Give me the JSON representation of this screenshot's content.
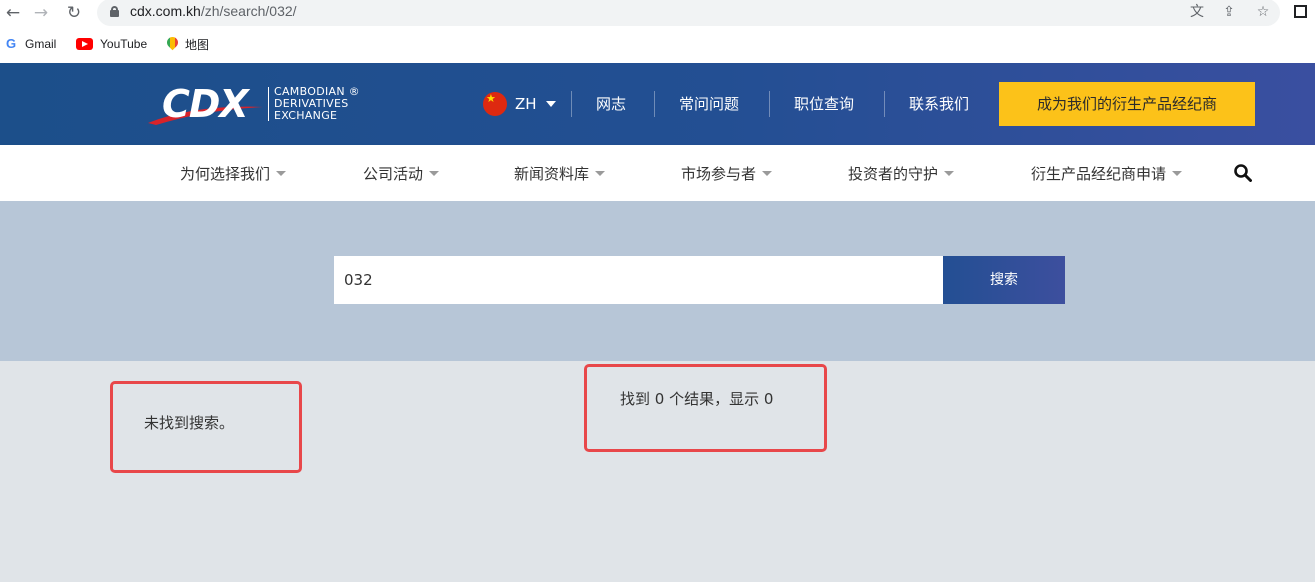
{
  "browser": {
    "url_host": "cdx.com.kh",
    "url_path": "/zh/search/032/",
    "bookmarks": [
      {
        "label": "Gmail",
        "icon": "google-icon"
      },
      {
        "label": "YouTube",
        "icon": "youtube-icon"
      },
      {
        "label": "地图",
        "icon": "maps-icon"
      }
    ]
  },
  "header": {
    "logo_text": "CDX",
    "logo_lines": [
      "CAMBODIAN ®",
      "DERIVATIVES",
      "EXCHANGE"
    ],
    "language": "ZH",
    "links": [
      "网志",
      "常问问题",
      "职位查询",
      "联系我们"
    ],
    "cta_label": "成为我们的衍生产品经纪商",
    "accent_color": "#fcc219",
    "brand_color": "#1c4f8a"
  },
  "nav": {
    "items": [
      "为何选择我们",
      "公司活动",
      "新闻资料库",
      "市场参与者",
      "投资者的守护",
      "衍生产品经纪商申请"
    ]
  },
  "search": {
    "value": "032",
    "button_label": "搜索"
  },
  "results": {
    "not_found": "未找到搜索。",
    "count_text": "找到 0 个结果，显示 0"
  }
}
